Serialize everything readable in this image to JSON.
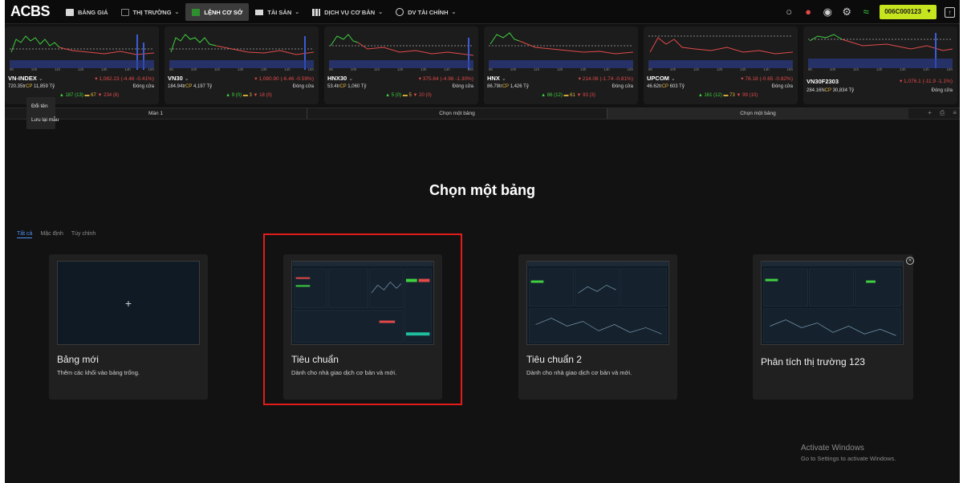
{
  "app": {
    "logo": "ACBS"
  },
  "nav": [
    {
      "label": "BẢNG GIÁ",
      "icon": "price-board-icon",
      "has_caret": false
    },
    {
      "label": "THỊ TRƯỜNG",
      "icon": "market-icon",
      "has_caret": true
    },
    {
      "label": "LỆNH CƠ SỞ",
      "icon": "order-icon",
      "has_caret": false
    },
    {
      "label": "TÀI SẢN",
      "icon": "asset-icon",
      "has_caret": true
    },
    {
      "label": "DỊCH VỤ CƠ BẢN",
      "icon": "service-icon",
      "has_caret": true
    },
    {
      "label": "DV TÀI CHÍNH",
      "icon": "finance-icon",
      "has_caret": true
    }
  ],
  "header": {
    "account": "006C000123",
    "accent": "#c7e51e"
  },
  "indices": [
    {
      "name": "VN-INDEX",
      "change": "1,082.23 (-4.46 -0.41%)",
      "volume": "720.35tr",
      "vol_unit": "CP",
      "value": "11,859 Tỷ",
      "status": "Đóng cửa",
      "up": "187",
      "up_ceil": "(13)",
      "eq": "67",
      "down": "234",
      "down_floor": "(8)"
    },
    {
      "name": "VN30",
      "change": "1,080.90 (-6.46 -0.59%)",
      "volume": "184.94tr",
      "vol_unit": "CP",
      "value": "4,197 Tỷ",
      "status": "Đóng cửa",
      "up": "9",
      "up_ceil": "(0)",
      "eq": "3",
      "down": "18",
      "down_floor": "(0)"
    },
    {
      "name": "HNX30",
      "change": "375.64 (-4.96 -1.30%)",
      "volume": "53.4tr",
      "vol_unit": "CP",
      "value": "1,060 Tỷ",
      "status": "Đóng cửa",
      "up": "5",
      "up_ceil": "(0)",
      "eq": "5",
      "down": "20",
      "down_floor": "(0)"
    },
    {
      "name": "HNX",
      "change": "214.08 (-1.74 -0.81%)",
      "volume": "86.79tr",
      "vol_unit": "CP",
      "value": "1,426 Tỷ",
      "status": "Đóng cửa",
      "up": "86",
      "up_ceil": "(12)",
      "eq": "61",
      "down": "93",
      "down_floor": "(3)"
    },
    {
      "name": "UPCOM",
      "change": "78.18 (-0.65 -0.82%)",
      "volume": "46.62tr",
      "vol_unit": "CP",
      "value": "603 Tỷ",
      "status": "Đóng cửa",
      "up": "161",
      "up_ceil": "(12)",
      "eq": "73",
      "down": "99",
      "down_floor": "(10)"
    },
    {
      "name": "VN30F2303",
      "change": "1,076.1 (-11.9 -1.1%)",
      "volume": "284.16N",
      "vol_unit": "CP",
      "value": "30,834 Tỷ",
      "status": "Đóng cửa"
    }
  ],
  "time_ticks": [
    "9h",
    "10h",
    "11h",
    "12h",
    "13h",
    "14h",
    "15h"
  ],
  "context_menu": [
    "Đổi tên",
    "Lưu lại mẫu"
  ],
  "screen_tabs": [
    "Màn 1",
    "Chọn một bảng",
    "Chọn một bảng"
  ],
  "tab_actions": [
    "+",
    "⎙",
    "≡"
  ],
  "main": {
    "heading": "Chọn một bảng",
    "filters": [
      "Tất cả",
      "Mặc định",
      "Tùy chỉnh"
    ]
  },
  "templates": [
    {
      "title": "Bảng mới",
      "desc": "Thêm các khối vào bảng trống.",
      "plus": "+"
    },
    {
      "title": "Tiêu chuẩn",
      "desc": "Dành cho nhà giao dịch cơ bản và mới."
    },
    {
      "title": "Tiêu chuẩn 2",
      "desc": "Dành cho nhà giao dịch cơ bản và mới."
    },
    {
      "title": "Phân tích thị trường 123",
      "desc": ""
    }
  ],
  "watermark": {
    "title": "Activate Windows",
    "sub": "Go to Settings to activate Windows."
  }
}
